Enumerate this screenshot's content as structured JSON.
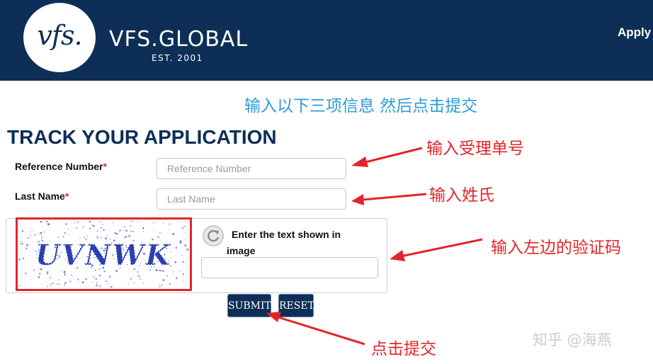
{
  "header": {
    "logo_mark": "vfs.",
    "brand_name": "VFS.GLOBAL",
    "brand_est": "EST. 2001",
    "apply_link": "Apply"
  },
  "instruction": "输入以下三项信息 然后点击提交",
  "form": {
    "title": "TRACK YOUR APPLICATION",
    "reference": {
      "label": "Reference Number",
      "required_mark": "*",
      "placeholder": "Reference Number",
      "value": ""
    },
    "last_name": {
      "label": "Last Name",
      "required_mark": "*",
      "placeholder": "Last Name",
      "value": ""
    },
    "captcha": {
      "image_text": "UVNWK",
      "prompt": "Enter the text shown in image",
      "value": ""
    },
    "submit_label": "SUBMIT",
    "reset_label": "RESET"
  },
  "annotations": {
    "reference": "输入受理单号",
    "last_name": "输入姓氏",
    "captcha": "输入左边的验证码",
    "submit": "点击提交"
  },
  "watermark": "知乎 @海燕",
  "colors": {
    "header_bg": "#0d2f57",
    "title": "#0d2f57",
    "instruction": "#2c9bd7",
    "annotation": "#e3252a",
    "button_bg": "#0d2f57",
    "captcha_text": "#2a3fb0"
  },
  "icons": {
    "refresh": "refresh-icon",
    "arrow": "arrow-icon"
  }
}
